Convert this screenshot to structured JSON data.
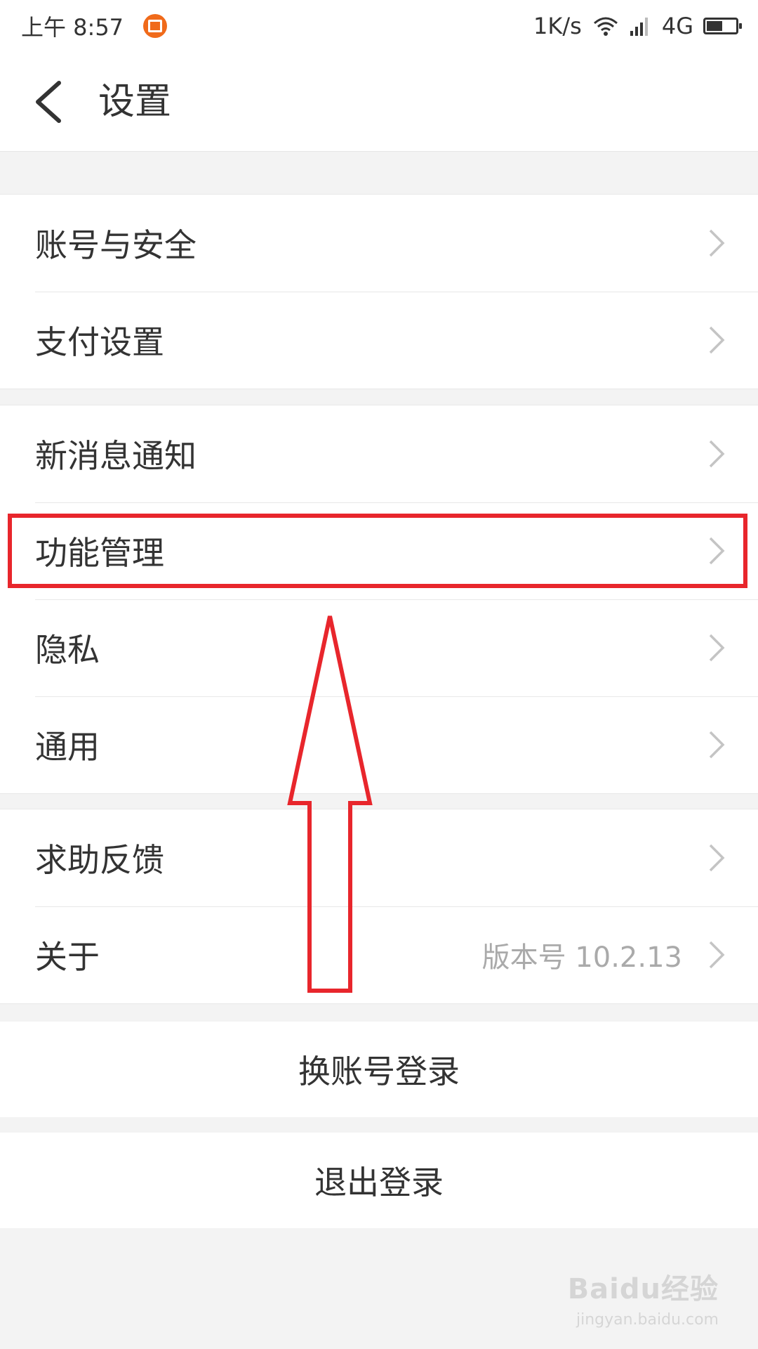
{
  "status_bar": {
    "time": "上午 8:57",
    "network_speed": "1K/s",
    "network_type": "4G",
    "battery_level": 0.55,
    "icons": [
      "notification-icon",
      "wifi-icon",
      "signal-icon",
      "battery-icon"
    ]
  },
  "header": {
    "title": "设置",
    "back_icon": "chevron-left-icon"
  },
  "groups": [
    {
      "items": [
        {
          "label": "账号与安全"
        },
        {
          "label": "支付设置"
        }
      ]
    },
    {
      "items": [
        {
          "label": "新消息通知"
        },
        {
          "label": "功能管理",
          "highlighted": true
        },
        {
          "label": "隐私"
        },
        {
          "label": "通用"
        }
      ]
    },
    {
      "items": [
        {
          "label": "求助反馈"
        },
        {
          "label": "关于",
          "value": "版本号 10.2.13"
        }
      ]
    }
  ],
  "actions": {
    "switch_account": "换账号登录",
    "logout": "退出登录"
  },
  "annotation": {
    "color": "#e8262c"
  },
  "watermark": {
    "logo": "Baidu经验",
    "url": "jingyan.baidu.com"
  }
}
